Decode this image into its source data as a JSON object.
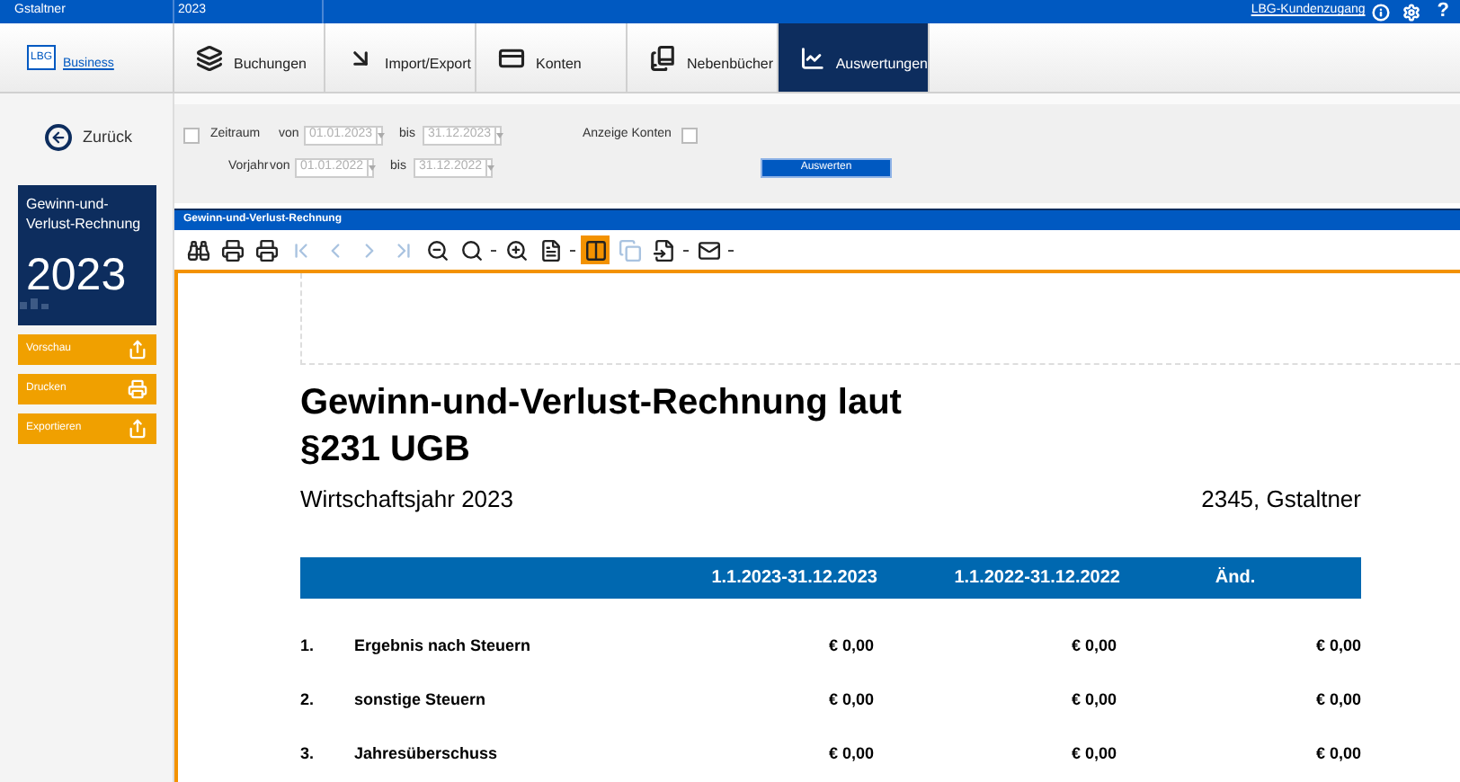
{
  "top_bar": {
    "client": "Gstaltner",
    "year": "2023",
    "account_link": "LBG-Kundenzugang",
    "help": "?"
  },
  "logo": {
    "mark": "LBG",
    "text": "Business"
  },
  "tabs": [
    {
      "label": "Buchungen",
      "selected": false
    },
    {
      "label": "Import/Export",
      "selected": false
    },
    {
      "label": "Konten",
      "selected": false
    },
    {
      "label": "Nebenbücher",
      "selected": false
    },
    {
      "label": "Auswertungen",
      "selected": true
    }
  ],
  "back_button": "Zurück",
  "filter": {
    "period": {
      "label": "Zeitraum",
      "checked": false,
      "from_label": "von",
      "from": "01.01.2023",
      "to_label": "bis",
      "to": "31.12.2023",
      "disabled": true
    },
    "prior_year": {
      "label": "Vorjahr",
      "from_label": "von",
      "from": "01.01.2022",
      "to_label": "bis",
      "to": "31.12.2022",
      "disabled": true
    },
    "show_accounts": {
      "label": "Anzeige Konten",
      "checked": false
    },
    "submit": "Auswerten"
  },
  "report_card": {
    "title": "Gewinn-und-Verlust-Rechnung",
    "year": "2023"
  },
  "actions": [
    "Vorschau",
    "Drucken",
    "Exportieren"
  ],
  "viewer": {
    "title": "Gewinn-und-Verlust-Rechnung",
    "toolbar": [
      {
        "disabled": false,
        "selected": false
      },
      {
        "disabled": false,
        "selected": false
      },
      {
        "disabled": false,
        "selected": false
      },
      {
        "disabled": true,
        "selected": false
      },
      {
        "disabled": true,
        "selected": false
      },
      {
        "disabled": true,
        "selected": false
      },
      {
        "disabled": true,
        "selected": false
      },
      {
        "disabled": false,
        "selected": false
      },
      {
        "disabled": false,
        "selected": false
      },
      {
        "disabled": false,
        "selected": false
      },
      {
        "disabled": false,
        "selected": false
      },
      {
        "disabled": false,
        "selected": true
      },
      {
        "disabled": true,
        "selected": false
      },
      {
        "disabled": false,
        "selected": false
      },
      {
        "disabled": false,
        "selected": false
      }
    ]
  },
  "report": {
    "title": "Gewinn-und-Verlust-Rechnung laut §231 UGB",
    "fiscal_year": "Wirtschaftsjahr 2023",
    "client": "2345, Gstaltner",
    "columns": [
      "1.1.2023-31.12.2023",
      "1.1.2022-31.12.2022",
      "Änd."
    ],
    "rows": [
      {
        "number": "1.",
        "label": "Ergebnis nach Steuern",
        "values": [
          "€ 0,00",
          "€ 0,00",
          "€ 0,00"
        ]
      },
      {
        "number": "2.",
        "label": "sonstige Steuern",
        "values": [
          "€ 0,00",
          "€ 0,00",
          "€ 0,00"
        ]
      },
      {
        "number": "3.",
        "label": "Jahresüberschuss",
        "values": [
          "€ 0,00",
          "€ 0,00",
          "€ 0,00"
        ]
      }
    ]
  }
}
